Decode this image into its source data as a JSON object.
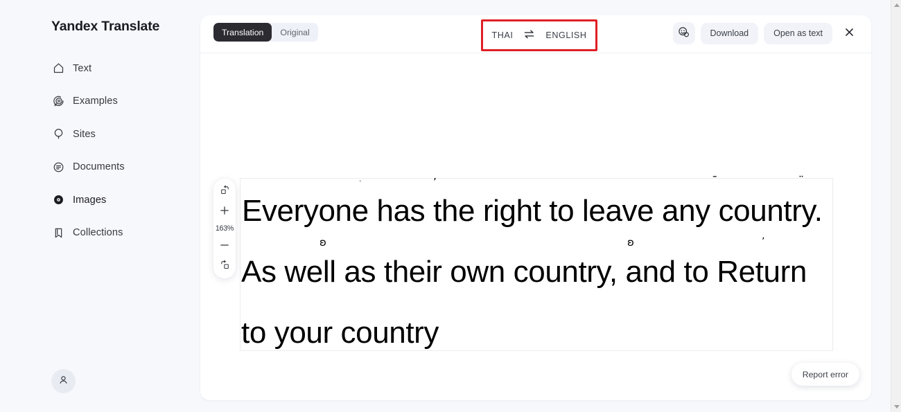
{
  "app": {
    "brand": "Yandex Translate"
  },
  "sidebar": {
    "items": [
      {
        "label": "Text",
        "icon": "home-icon",
        "active": false
      },
      {
        "label": "Examples",
        "icon": "examples-icon",
        "active": false
      },
      {
        "label": "Sites",
        "icon": "sites-icon",
        "active": false
      },
      {
        "label": "Documents",
        "icon": "documents-icon",
        "active": false
      },
      {
        "label": "Images",
        "icon": "images-icon",
        "active": true
      },
      {
        "label": "Collections",
        "icon": "collections-icon",
        "active": false
      }
    ],
    "account_icon": "user-avatar-icon"
  },
  "toolbar": {
    "view_modes": [
      {
        "label": "Translation",
        "selected": true
      },
      {
        "label": "Original",
        "selected": false
      }
    ],
    "source_language": "THAI",
    "target_language": "ENGLISH",
    "swap_icon": "swap-arrows-icon",
    "feedback_icon": "feedback-smiley-icon",
    "download_label": "Download",
    "open_as_text_label": "Open as text",
    "close_icon": "close-icon",
    "highlight_color": "#e01f26"
  },
  "viewer": {
    "rotate_left_icon": "rotate-counterclockwise-icon",
    "zoom_in_icon": "plus-icon",
    "zoom_level": "163%",
    "zoom_out_icon": "minus-icon",
    "rotate_right_icon": "rotate-clockwise-icon",
    "report_error_label": "Report error",
    "translated_image": {
      "lines": [
        "Everyone has the right to leave any country.",
        "As well as their own country, and to Return",
        "to your country"
      ]
    }
  },
  "scrollbar": {
    "up_icon": "scroll-up-arrow-icon",
    "down_icon": "scroll-down-arrow-icon"
  }
}
